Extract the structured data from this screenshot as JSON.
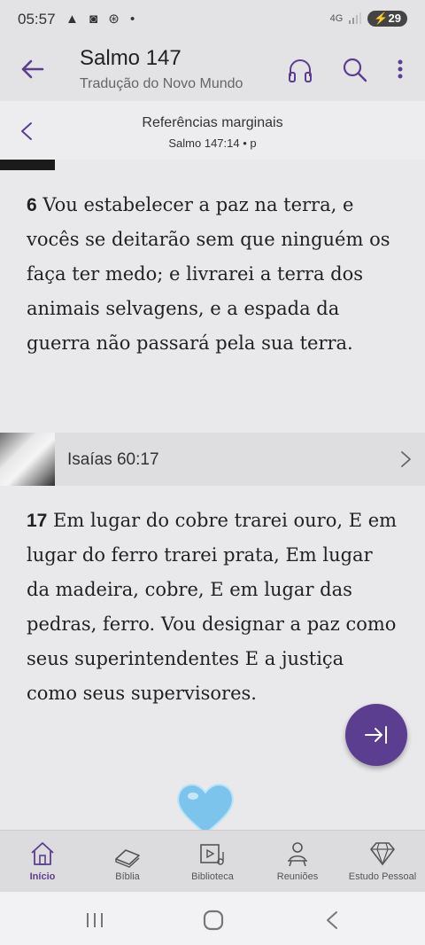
{
  "status_bar": {
    "time": "05:57",
    "signal_text": "4G",
    "battery": "29"
  },
  "app_bar": {
    "title": "Salmo 147",
    "subtitle": "Tradução do Novo Mundo"
  },
  "ref_header": {
    "title": "Referências marginais",
    "subtitle": "Salmo 147:14 • p"
  },
  "verse1": {
    "number": "6",
    "text": "Vou estabelecer a paz na terra, e vocês se deitarão sem que ninguém os faça ter medo; e livrarei a terra dos animais selvagens, e a espada da guerra não passará pela sua terra."
  },
  "ref_link": {
    "label": "Isaías 60:17"
  },
  "verse2": {
    "number": "17",
    "text": "Em lugar do cobre trarei ouro, E em lugar do ferro trarei prata, Em lugar da madeira, cobre, E em lugar das pedras, ferro. Vou designar a paz como seus superintendentes E a justiça como seus supervisores."
  },
  "nav": [
    {
      "label": "Início",
      "icon": "home-icon",
      "active": true
    },
    {
      "label": "Bíblia",
      "icon": "bible-icon",
      "active": false
    },
    {
      "label": "Biblioteca",
      "icon": "library-icon",
      "active": false
    },
    {
      "label": "Reuniões",
      "icon": "meetings-icon",
      "active": false
    },
    {
      "label": "Estudo Pessoal",
      "icon": "diamond-icon",
      "active": false
    }
  ],
  "colors": {
    "accent": "#5b3e8f",
    "heart": "#7cc4ec"
  }
}
